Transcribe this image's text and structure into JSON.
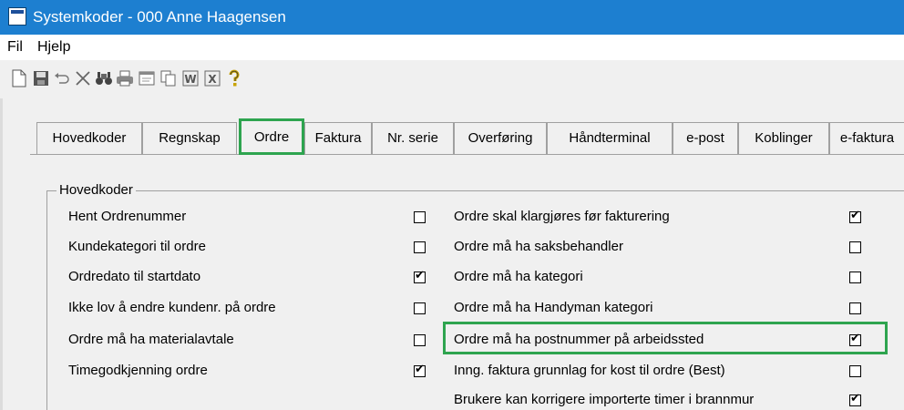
{
  "window": {
    "title": "Systemkoder - 000 Anne Haagensen"
  },
  "menu": [
    "Fil",
    "Hjelp"
  ],
  "toolbar": {
    "icons": [
      "new-document-icon",
      "save-icon",
      "undo-icon",
      "delete-icon",
      "search-icon",
      "print-icon",
      "preview-icon",
      "copy-icon",
      "word-export-icon",
      "excel-export-icon",
      "help-icon"
    ]
  },
  "tabs": [
    {
      "label": "Hovedkoder"
    },
    {
      "label": "Regnskap"
    },
    {
      "label": "Ordre",
      "active": true
    },
    {
      "label": "Faktura"
    },
    {
      "label": "Nr. serie"
    },
    {
      "label": "Overføring"
    },
    {
      "label": "Håndterminal"
    },
    {
      "label": "e-post"
    },
    {
      "label": "Koblinger"
    },
    {
      "label": "e-faktura"
    }
  ],
  "group": {
    "title": "Hovedkoder",
    "left": [
      {
        "label": "Hent Ordrenummer",
        "checked": false
      },
      {
        "label": "Kundekategori til ordre",
        "checked": false
      },
      {
        "label": "Ordredato til startdato",
        "checked": true
      },
      {
        "label": "Ikke lov å endre kundenr. på ordre",
        "checked": false
      },
      {
        "label": "Ordre må ha materialavtale",
        "checked": false
      },
      {
        "label": "Timegodkjenning ordre",
        "checked": true
      }
    ],
    "right": [
      {
        "label": "Ordre skal klargjøres før fakturering",
        "checked": true
      },
      {
        "label": "Ordre må ha saksbehandler",
        "checked": false
      },
      {
        "label": "Ordre må ha kategori",
        "checked": false
      },
      {
        "label": "Ordre må ha Handyman kategori",
        "checked": false
      },
      {
        "label": "Ordre må ha postnummer på arbeidssted",
        "checked": true,
        "highlighted": true
      },
      {
        "label": "Inng. faktura grunnlag for kost til ordre (Best)",
        "checked": false
      },
      {
        "label": "Brukere kan korrigere importerte timer i brannmur",
        "checked": true
      }
    ]
  },
  "colors": {
    "titlebar": "#1d7fd0",
    "highlight": "#2ea44f",
    "panel": "#f0f0f0"
  }
}
